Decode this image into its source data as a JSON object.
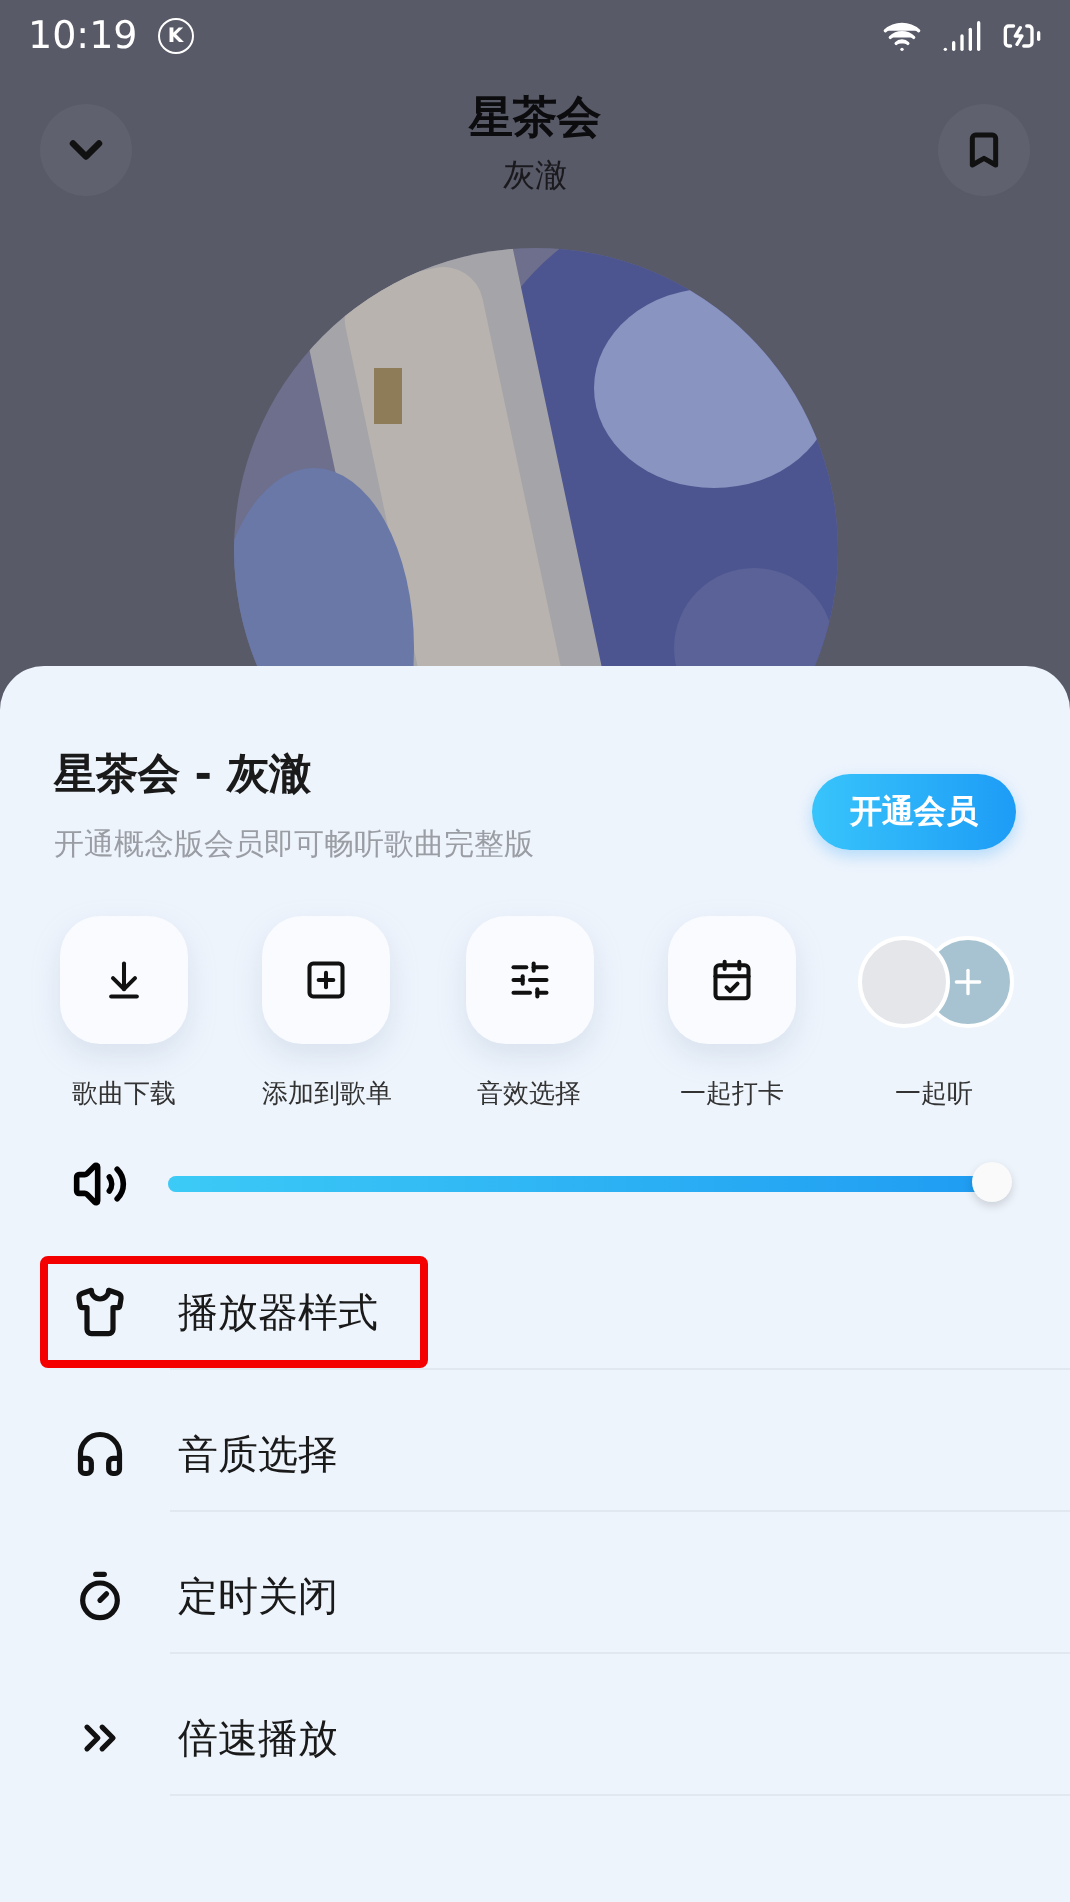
{
  "status_bar": {
    "time": "10:19",
    "badge": "K"
  },
  "header": {
    "title": "星茶会",
    "artist": "灰澈"
  },
  "sheet": {
    "title": "星茶会 - 灰澈",
    "subtitle": "开通概念版会员即可畅听歌曲完整版",
    "vip_button": "开通会员",
    "actions": [
      {
        "kind": "download",
        "label": "歌曲下载"
      },
      {
        "kind": "add",
        "label": "添加到歌单"
      },
      {
        "kind": "effects",
        "label": "音效选择"
      },
      {
        "kind": "checkin",
        "label": "一起打卡"
      },
      {
        "kind": "listen",
        "label": "一起听"
      }
    ],
    "volume": {
      "level": 0.99
    },
    "menu": [
      {
        "kind": "style",
        "label": "播放器样式",
        "highlighted": true
      },
      {
        "kind": "quality",
        "label": "音质选择",
        "highlighted": false
      },
      {
        "kind": "timer",
        "label": "定时关闭",
        "highlighted": false
      },
      {
        "kind": "speed",
        "label": "倍速播放",
        "highlighted": false
      }
    ]
  }
}
